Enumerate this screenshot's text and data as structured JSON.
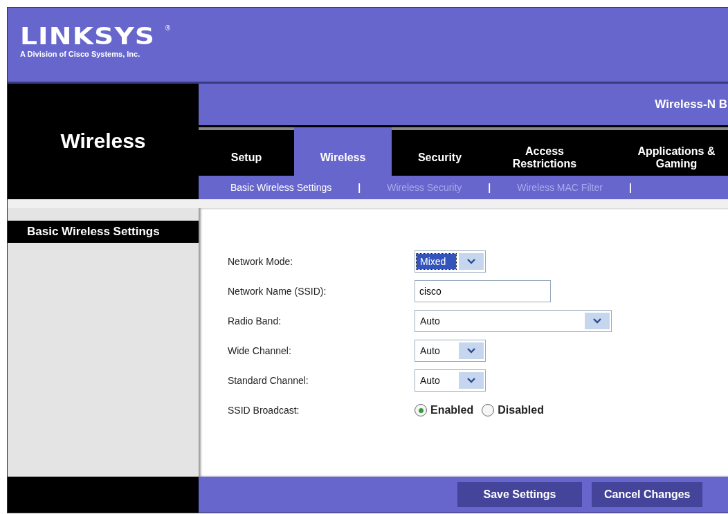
{
  "brand": {
    "logo": "LINKSYS",
    "registered": "®",
    "subtitle": "A Division of Cisco Systems, Inc."
  },
  "section_title": "Wireless",
  "product_title": "Wireless-N B",
  "tabs": [
    {
      "label": "Setup",
      "selected": false
    },
    {
      "label": "Wireless",
      "selected": true
    },
    {
      "label": "Security",
      "selected": false
    },
    {
      "label": "Access Restrictions",
      "selected": false
    },
    {
      "label": "Applications & Gaming",
      "selected": false
    }
  ],
  "subtabs": [
    {
      "label": "Basic Wireless Settings",
      "selected": true
    },
    {
      "label": "Wireless Security",
      "selected": false
    },
    {
      "label": "Wireless MAC Filter",
      "selected": false
    }
  ],
  "subtab_separator": "|",
  "sidebar_heading": "Basic Wireless Settings",
  "fields": [
    {
      "kind": "select",
      "label": "Network Mode:",
      "value": "Mixed",
      "highlighted": true
    },
    {
      "kind": "text",
      "label": "Network Name (SSID):",
      "value": "cisco"
    },
    {
      "kind": "wide_select",
      "label": "Radio Band:",
      "value": "Auto",
      "highlighted": false
    },
    {
      "kind": "select",
      "label": "Wide Channel:",
      "value": "Auto",
      "highlighted": false
    },
    {
      "kind": "select",
      "label": "Standard Channel:",
      "value": "Auto",
      "highlighted": false
    },
    {
      "kind": "radio",
      "label": "SSID Broadcast:",
      "options": [
        {
          "label": "Enabled",
          "selected": true
        },
        {
          "label": "Disabled",
          "selected": false
        }
      ]
    }
  ],
  "buttons": [
    "Save Settings",
    "Cancel Changes"
  ]
}
